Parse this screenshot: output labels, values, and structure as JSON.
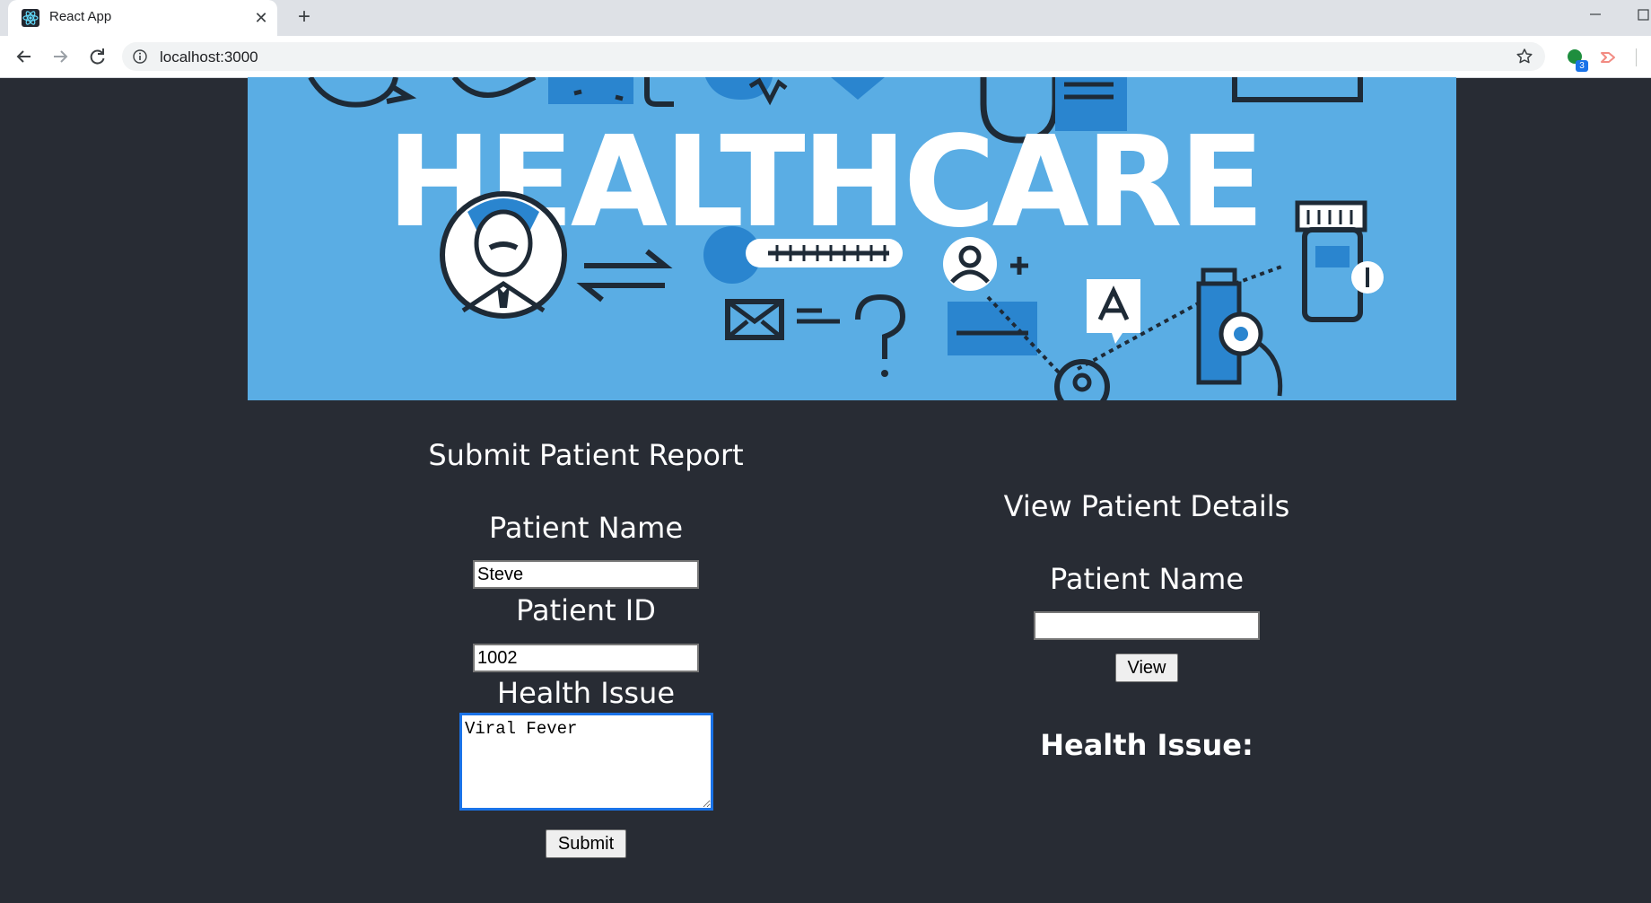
{
  "browser": {
    "tab_title": "React App",
    "url": "localhost:3000",
    "extension_badge": "3"
  },
  "banner": {
    "text": "HEALTHCARE"
  },
  "submit_form": {
    "title": "Submit Patient Report",
    "name_label": "Patient Name",
    "name_value": "Steve",
    "id_label": "Patient ID",
    "id_value": "1002",
    "issue_label": "Health Issue",
    "issue_value": "Viral Fever",
    "submit_label": "Submit"
  },
  "view_form": {
    "title": "View Patient Details",
    "name_label": "Patient Name",
    "name_value": "",
    "view_label": "View",
    "result_label": "Health Issue:"
  },
  "colors": {
    "page_background": "#282c34",
    "banner_background": "#5aade4",
    "banner_dark": "#1e2a36",
    "banner_accent": "#2a85cf"
  }
}
